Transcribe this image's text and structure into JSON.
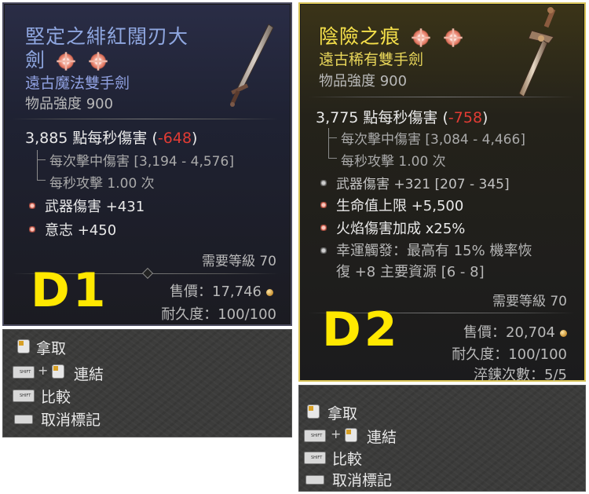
{
  "item1": {
    "name_line1": "堅定之緋紅闊刃大",
    "name_line2": "劍",
    "type": "遠古魔法雙手劍",
    "power": "物品強度 900",
    "dps_text": "3,885 點每秒傷害",
    "dps_diff_open": "(",
    "dps_diff": "-648",
    "dps_diff_close": ")",
    "per_hit": "每次擊中傷害 [3,194 - 4,576]",
    "attack_speed": "每秒攻擊 1.00 次",
    "affix1": "武器傷害 +431",
    "affix2": "意志 +450",
    "required_level": "需要等級 70",
    "sell_label": "售價：",
    "sell_value": "17,746",
    "durability_label": "耐久度：",
    "durability_value": "100/100",
    "annotation": "D1"
  },
  "item2": {
    "name": "陰險之痕",
    "type": "遠古稀有雙手劍",
    "power": "物品強度 900",
    "dps_text": "3,775 點每秒傷害",
    "dps_diff_open": "(",
    "dps_diff": "-758",
    "dps_diff_close": ")",
    "per_hit": "每次擊中傷害 [3,084 - 4,466]",
    "attack_speed": "每秒攻擊 1.00 次",
    "implicit": "武器傷害 +321 [207 - 345]",
    "affix1": "生命值上限 +5,500",
    "affix2": "火焰傷害加成 x25%",
    "aspect_line1": "幸運觸發：最高有 15% 機率恢",
    "aspect_line2": "復 +8 主要資源 [6 - 8]",
    "required_level": "需要等級 70",
    "sell_label": "售價：",
    "sell_value": "20,704",
    "durability_label": "耐久度：",
    "durability_value": "100/100",
    "temper_label": "淬鍊次數：",
    "temper_value": "5/5",
    "annotation": "D2"
  },
  "actions": {
    "pickup": "拿取",
    "link": "連結",
    "compare": "比較",
    "unmark": "取消標記",
    "plus": "+"
  },
  "colors": {
    "legendary_title": "#f5e04a",
    "magic_title": "#8fa7e0",
    "negative": "#e23c34",
    "annotation": "#ffe800"
  }
}
